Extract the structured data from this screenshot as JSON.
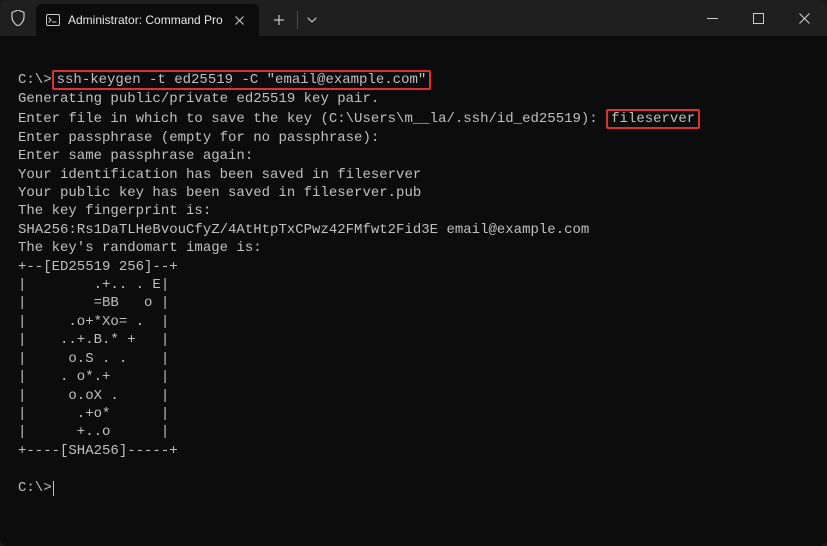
{
  "titlebar": {
    "tab_title": "Administrator: Command Pro"
  },
  "terminal": {
    "prompt1": "C:\\>",
    "cmd": "ssh-keygen -t ed25519 -C \"email@example.com\"",
    "line2": "Generating public/private ed25519 key pair.",
    "line3_pre": "Enter file in which to save the key (C:\\Users\\m__la/.ssh/id_ed25519): ",
    "line3_hl": "fileserver",
    "line4": "Enter passphrase (empty for no passphrase):",
    "line5": "Enter same passphrase again:",
    "line6": "Your identification has been saved in fileserver",
    "line7": "Your public key has been saved in fileserver.pub",
    "line8": "The key fingerprint is:",
    "line9": "SHA256:Rs1DaTLHeBvouCfyZ/4AtHtpTxCPwz42FMfwt2Fid3E email@example.com",
    "line10": "The key's randomart image is:",
    "art1": "+--[ED25519 256]--+",
    "art2": "|        .+.. . E|",
    "art3": "|        =BB   o |",
    "art4": "|     .o+*Xo= .  |",
    "art5": "|    ..+.B.* +   |",
    "art6": "|     o.S . .    |",
    "art7": "|    . o*.+      |",
    "art8": "|     o.oX .     |",
    "art9": "|      .+o*      |",
    "art10": "|      +..o      |",
    "art11": "+----[SHA256]-----+",
    "prompt2": "C:\\>"
  }
}
